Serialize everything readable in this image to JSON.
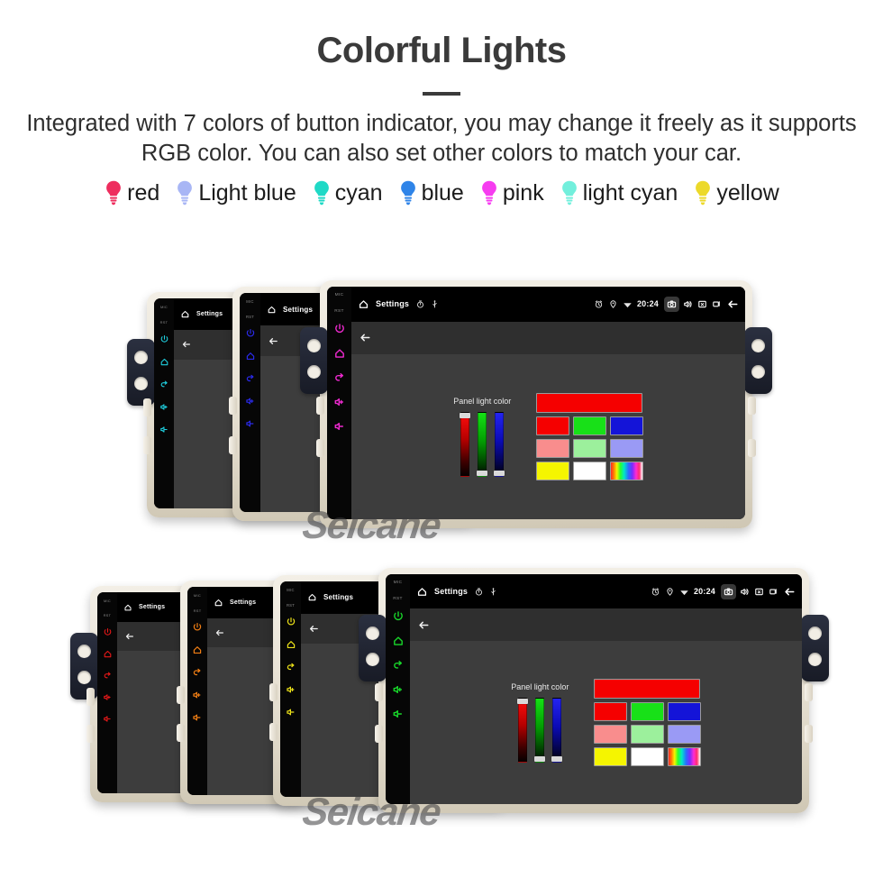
{
  "header": {
    "title": "Colorful Lights",
    "subtitle": "Integrated with 7 colors of button indicator, you may change it freely as it supports RGB color. You can also set other colors to match your car."
  },
  "legend": {
    "items": [
      {
        "label": "red",
        "color": "#ee2d5e",
        "icon": "bulb-icon"
      },
      {
        "label": "Light blue",
        "color": "#a8b6f5",
        "icon": "bulb-icon"
      },
      {
        "label": "cyan",
        "color": "#1fd9c6",
        "icon": "bulb-icon"
      },
      {
        "label": "blue",
        "color": "#2f84e8",
        "icon": "bulb-icon"
      },
      {
        "label": "pink",
        "color": "#f63cf0",
        "icon": "bulb-icon"
      },
      {
        "label": "light cyan",
        "color": "#72efdc",
        "icon": "bulb-icon"
      },
      {
        "label": "yellow",
        "color": "#ecd92a",
        "icon": "bulb-icon"
      }
    ]
  },
  "watermark": {
    "text": "Seicane"
  },
  "device": {
    "side_buttons": {
      "mic_label": "MIC",
      "rst_label": "RST",
      "icons": [
        "power-icon",
        "home-icon",
        "back-icon",
        "volume-up-icon",
        "volume-down-icon"
      ]
    },
    "statusbar": {
      "home_icon": "home-icon",
      "title": "Settings",
      "clock_icon": "timer-icon",
      "usb_icon": "usb-icon",
      "alarm_icon": "alarm-icon",
      "location_icon": "location-icon",
      "wifi_icon": "wifi-icon",
      "time": "20:24",
      "camera_icon": "camera-icon",
      "volume_icon": "volume-icon",
      "close_icon": "close-box-icon",
      "recents_icon": "recents-icon",
      "back_icon": "back-arrow-icon"
    },
    "actionbar": {
      "back_icon": "back-arrow-icon"
    },
    "panel": {
      "label": "Panel light color",
      "sliders": [
        {
          "name": "red-slider",
          "handle": "top"
        },
        {
          "name": "green-slider",
          "handle": "bottom"
        },
        {
          "name": "blue-slider",
          "handle": "bottom"
        }
      ],
      "preview_color": "#f50000",
      "swatch_rows": [
        [
          "#f50000",
          "#18e018",
          "#1414d8"
        ],
        [
          "#f98d8d",
          "#9cf09c",
          "#9a9af5"
        ],
        [
          "#f5f500",
          "#ffffff",
          "rainbow"
        ]
      ]
    }
  },
  "groups": {
    "top": {
      "name": "top-device-group",
      "units": [
        {
          "button_color": "#1fd0e0",
          "color_name": "cyan",
          "size": "small"
        },
        {
          "button_color": "#2a2ae8",
          "color_name": "blue",
          "size": "small"
        },
        {
          "button_color": "#ef2ad0",
          "color_name": "pink",
          "size": "large"
        }
      ]
    },
    "bottom": {
      "name": "bottom-device-group",
      "units": [
        {
          "button_color": "#e81818",
          "color_name": "red",
          "size": "small"
        },
        {
          "button_color": "#f07e14",
          "color_name": "orange",
          "size": "small"
        },
        {
          "button_color": "#ebe019",
          "color_name": "yellow",
          "size": "small"
        },
        {
          "button_color": "#18d62a",
          "color_name": "green",
          "size": "large"
        }
      ]
    }
  }
}
